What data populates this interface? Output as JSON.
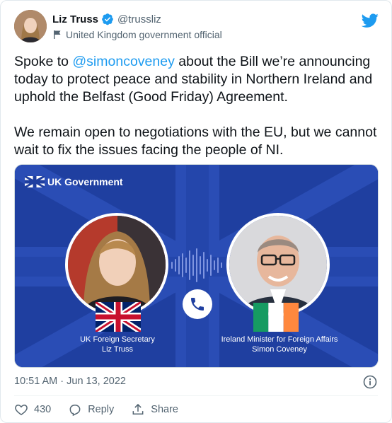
{
  "user": {
    "display_name": "Liz Truss",
    "handle": "@trussliz",
    "label": "United Kingdom government official",
    "verified": true
  },
  "tweet": {
    "text_before_mention": "Spoke to ",
    "mention": "@simoncoveney",
    "text_after_mention": " about the Bill we’re announcing today to protect peace and stability in Northern Ireland and uphold the Belfast (Good Friday) Agreement.",
    "paragraph_2": "We remain open to negotiations with the EU, but we cannot wait to fix the issues facing the people of NI."
  },
  "media": {
    "brand": "UK Government",
    "left_caption_line1": "UK Foreign Secretary",
    "left_caption_line2": "Liz Truss",
    "right_caption_line1": "Ireland Minister for Foreign Affairs",
    "right_caption_line2": "Simon Coveney"
  },
  "meta": {
    "timestamp": "10:51 AM · Jun 13, 2022"
  },
  "actions": {
    "like_count": "430",
    "reply_label": "Reply",
    "share_label": "Share"
  },
  "colors": {
    "link": "#1d9bf0",
    "muted": "#536471",
    "verified": "#1d9bf0",
    "media_bg": "#1f3fa0"
  },
  "icons": [
    "verified-badge-icon",
    "government-label-flag-icon",
    "twitter-bird-icon",
    "union-jack-icon",
    "phone-icon",
    "info-icon",
    "heart-icon",
    "reply-icon",
    "share-icon"
  ]
}
